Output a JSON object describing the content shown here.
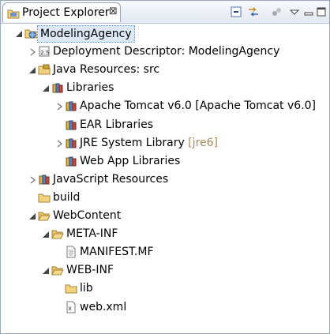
{
  "view": {
    "title": "Project Explorer",
    "close_glyph": "⊠",
    "icons": [
      "collapse-all-icon",
      "link-with-editor-icon",
      "filter-icon",
      "view-menu-icon",
      "minimize-icon",
      "maximize-icon"
    ]
  },
  "tree": {
    "rows": [
      {
        "label": "ModelingAgency",
        "decoration": "",
        "icon": "web-project-icon",
        "twisty": "expanded",
        "selected": true
      },
      {
        "label": "Deployment Descriptor: ModelingAgency",
        "decoration": "",
        "icon": "deployment-descriptor-icon",
        "twisty": "collapsed"
      },
      {
        "label": "Java Resources: src",
        "decoration": "",
        "icon": "java-resources-icon",
        "twisty": "expanded"
      },
      {
        "label": "Libraries",
        "decoration": "",
        "icon": "library-icon",
        "twisty": "expanded"
      },
      {
        "label": "Apache Tomcat v6.0 [Apache Tomcat v6.0]",
        "decoration": "",
        "icon": "library-icon",
        "twisty": "collapsed"
      },
      {
        "label": "EAR Libraries",
        "decoration": "",
        "icon": "library-icon",
        "twisty": "none"
      },
      {
        "label": "JRE System Library ",
        "decoration": "[jre6]",
        "icon": "library-icon",
        "twisty": "collapsed"
      },
      {
        "label": "Web App Libraries",
        "decoration": "",
        "icon": "library-icon",
        "twisty": "none"
      },
      {
        "label": "JavaScript Resources",
        "decoration": "",
        "icon": "library-icon",
        "twisty": "collapsed"
      },
      {
        "label": "build",
        "decoration": "",
        "icon": "folder-icon",
        "twisty": "none"
      },
      {
        "label": "WebContent",
        "decoration": "",
        "icon": "folder-open-icon",
        "twisty": "expanded"
      },
      {
        "label": "META-INF",
        "decoration": "",
        "icon": "folder-open-icon",
        "twisty": "expanded"
      },
      {
        "label": "MANIFEST.MF",
        "decoration": "",
        "icon": "file-icon",
        "twisty": "none"
      },
      {
        "label": "WEB-INF",
        "decoration": "",
        "icon": "folder-open-icon",
        "twisty": "expanded"
      },
      {
        "label": "lib",
        "decoration": "",
        "icon": "folder-icon",
        "twisty": "none"
      },
      {
        "label": "web.xml",
        "decoration": "",
        "icon": "xml-file-icon",
        "twisty": "none"
      }
    ]
  }
}
